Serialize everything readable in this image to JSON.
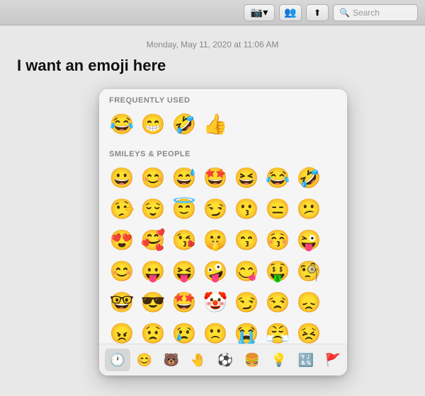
{
  "toolbar": {
    "search_placeholder": "Search",
    "icon1": "📷",
    "icon2": "👥",
    "icon3": "⬆"
  },
  "content": {
    "date": "Monday, May 11, 2020 at 11:06 AM",
    "message": "I want an emoji here"
  },
  "emoji_picker": {
    "sections": [
      {
        "label": "FREQUENTLY USED",
        "emojis": [
          "😂",
          "😁",
          "🤣",
          "👍"
        ]
      },
      {
        "label": "SMILEYS & PEOPLE",
        "emojis": [
          "😀",
          "😊",
          "😅",
          "🤩",
          "😆",
          "😂",
          "🤣",
          "🤥",
          "😌",
          "😇",
          "😏",
          "😗",
          "😑",
          "😕",
          "😍",
          "🥰",
          "😘",
          "🤫",
          "😙",
          "😚",
          "😜",
          "😊",
          "😛",
          "😝",
          "🤪",
          "😋",
          "🤑",
          "🧐",
          "🤓",
          "😎",
          "🤩",
          "🤡",
          "😏",
          "😒",
          "😞",
          "😠",
          "😟",
          "😢",
          "🙁",
          "😭",
          "😤",
          "😣"
        ]
      }
    ],
    "tabs": [
      {
        "icon": "🕐",
        "active": true
      },
      {
        "icon": "😊",
        "active": false
      },
      {
        "icon": "🐻",
        "active": false
      },
      {
        "icon": "🤚",
        "active": false
      },
      {
        "icon": "⚽",
        "active": false
      },
      {
        "icon": "🍔",
        "active": false
      },
      {
        "icon": "💡",
        "active": false
      },
      {
        "icon": "🔣",
        "active": false
      },
      {
        "icon": "🚩",
        "active": false
      },
      {
        "icon": "»",
        "active": false
      }
    ]
  }
}
